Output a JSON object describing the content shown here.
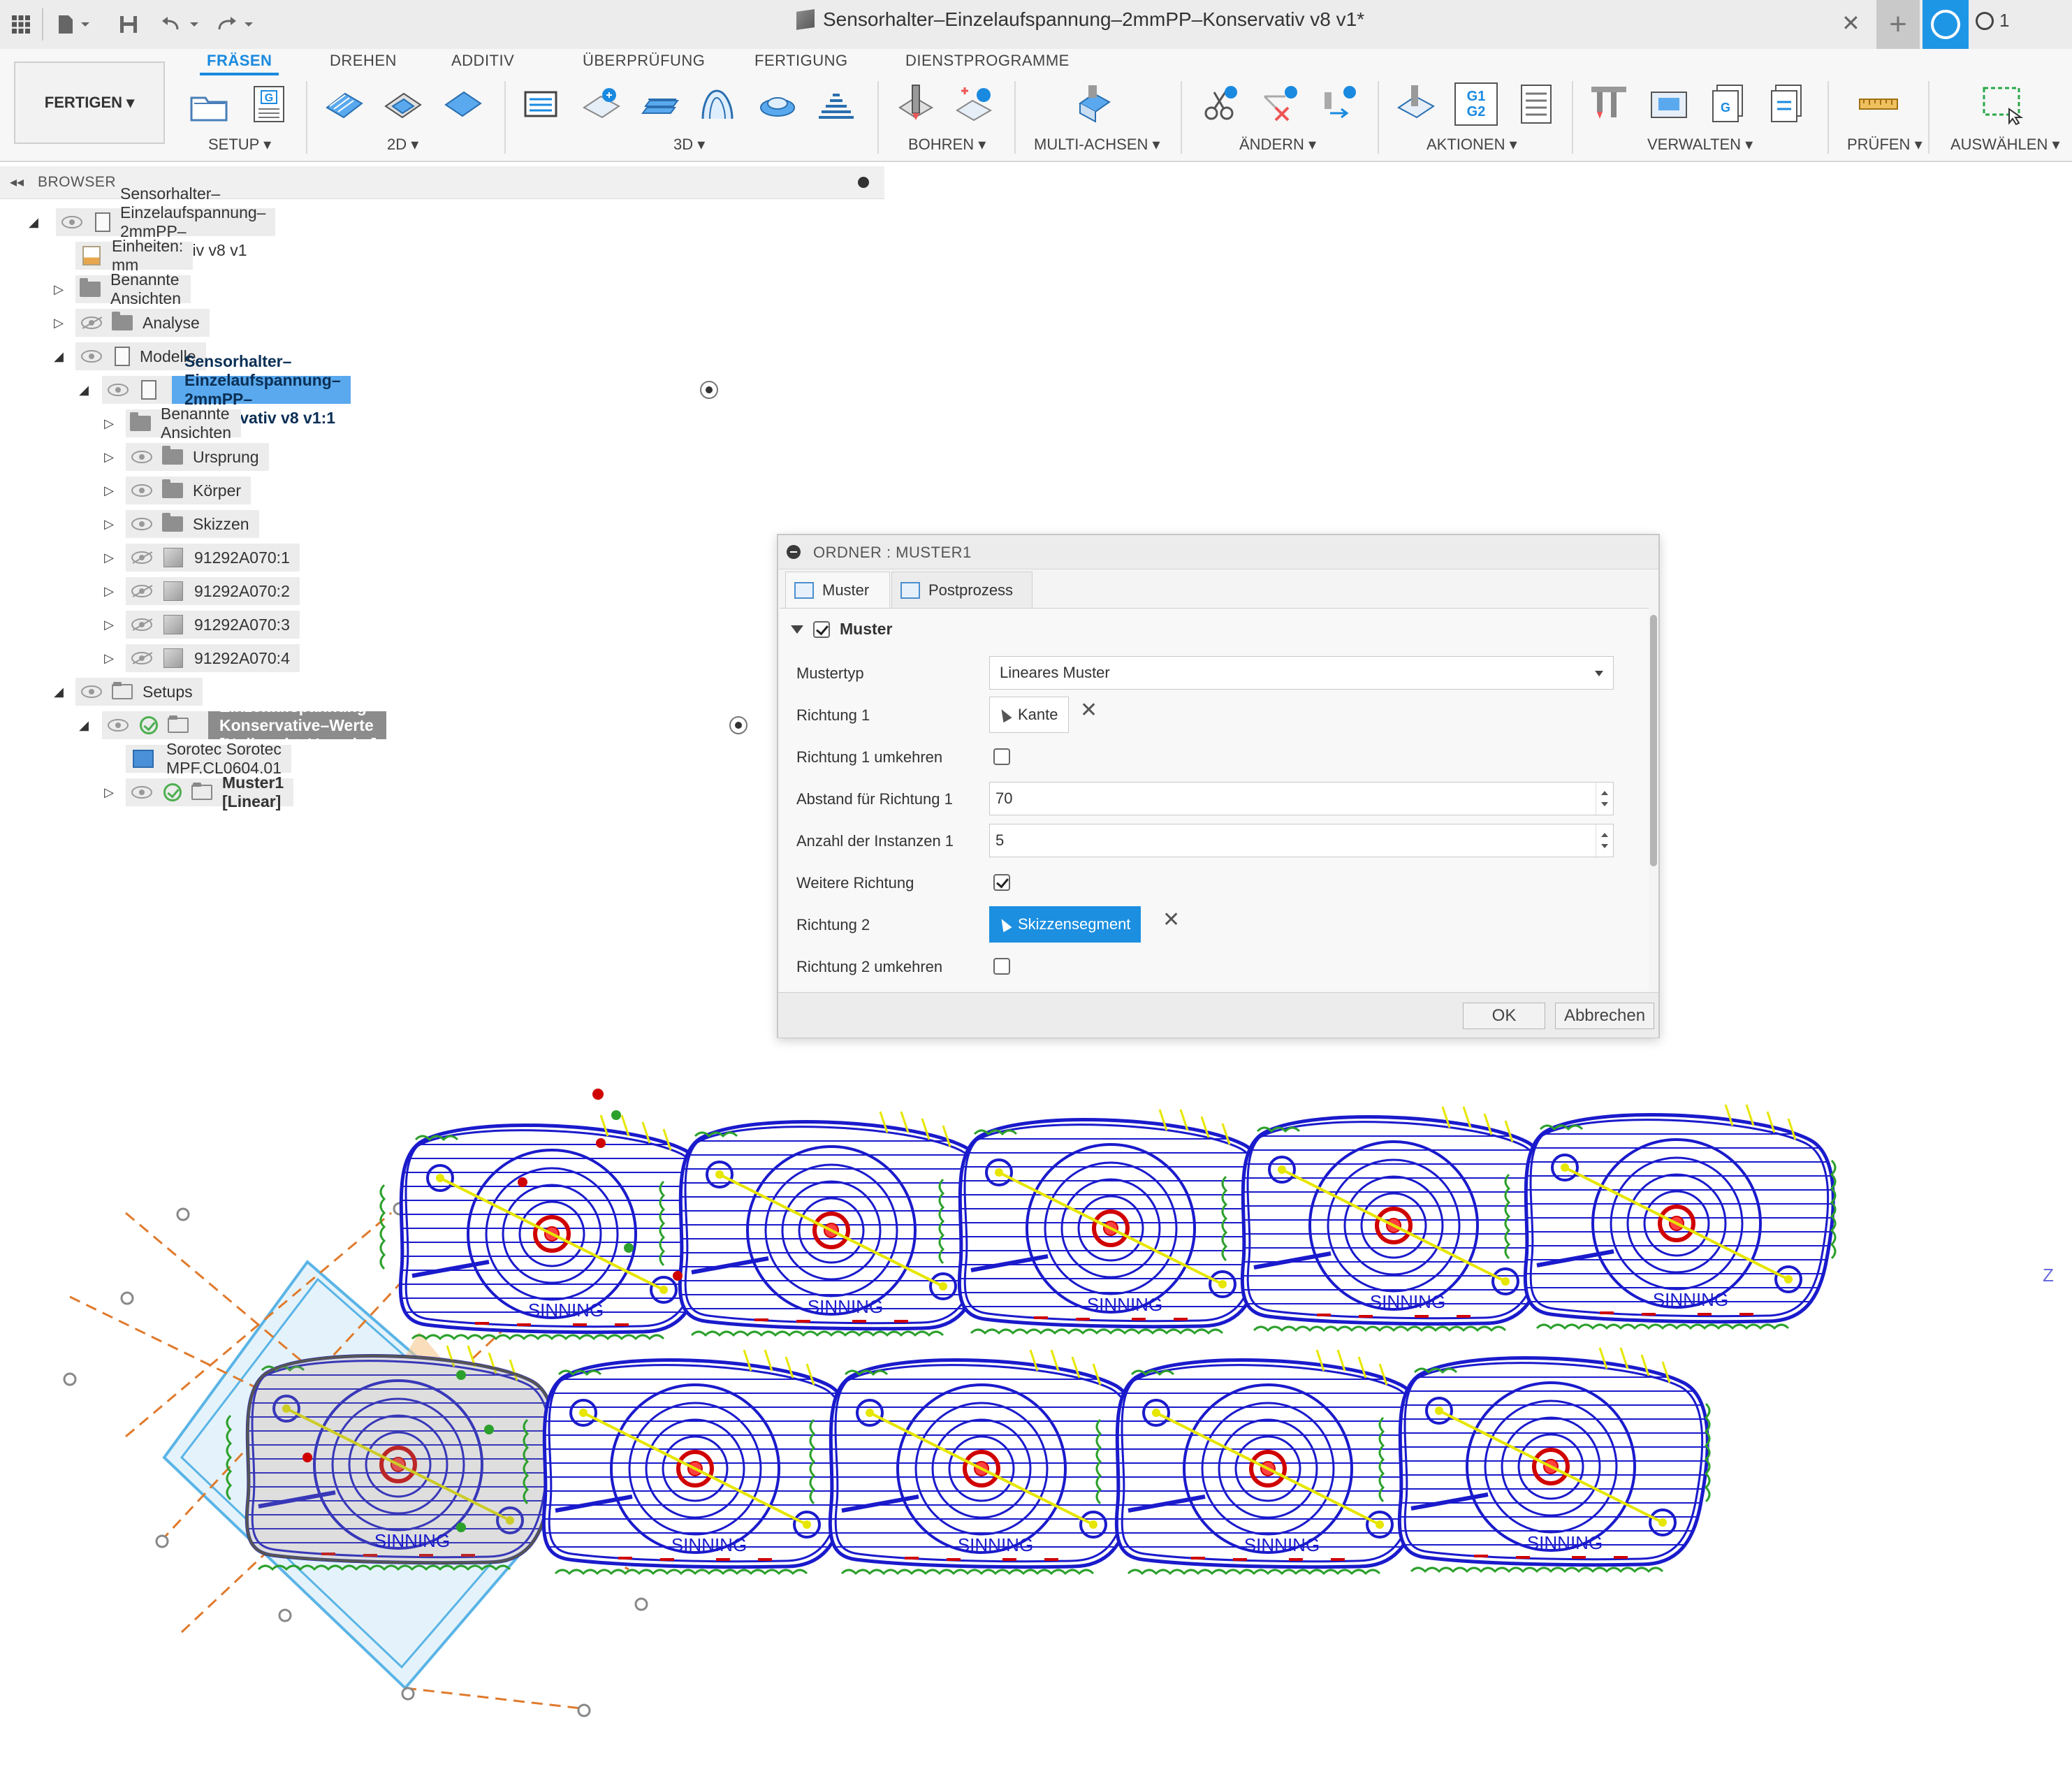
{
  "titlebar": {
    "document_title": "Sensorhalter–Einzelaufspannung–2mmPP–Konservativ v8 v1*",
    "job_count": "1",
    "icons": [
      "grid-icon",
      "file-icon",
      "save-icon",
      "undo-icon",
      "redo-icon",
      "close-icon",
      "plus-icon",
      "sync-icon",
      "clock-icon"
    ]
  },
  "ribbon": {
    "workspace_button": "FERTIGEN",
    "tabs": [
      "FRÄSEN",
      "DREHEN",
      "ADDITIV",
      "ÜBERPRÜFUNG",
      "FERTIGUNG",
      "DIENSTPROGRAMME"
    ],
    "active_tab": "FRÄSEN",
    "groups": [
      "SETUP",
      "2D",
      "3D",
      "BOHREN",
      "MULTI-ACHSEN",
      "ÄNDERN",
      "AKTIONEN",
      "VERWALTEN",
      "PRÜFEN",
      "AUSWÄHLEN"
    ],
    "aktionen_icon_text": [
      "G1",
      "G2"
    ],
    "accent_color": "#1a8ae0"
  },
  "browser": {
    "title": "BROWSER",
    "tree": {
      "root": "Sensorhalter–Einzelaufspannung–2mmPP–Konservativ v8 v1",
      "units": "Einheiten: mm",
      "named_views": "Benannte Ansichten",
      "analysis": "Analyse",
      "models": "Modelle",
      "model_component": "Sensorhalter–Einzelaufspannung–2mmPP–Konservativ v8 v1:1",
      "model_named_views": "Benannte Ansichten",
      "origin": "Ursprung",
      "bodies": "Körper",
      "sketches": "Skizzen",
      "parts": [
        "91292A070:1",
        "91292A070:2",
        "91292A070:3",
        "91292A070:4"
      ],
      "setups": "Setups",
      "setup": "Einzelaufspannung–Konservative–Werte [Nullpunkt=Vorgabe]",
      "machine": "Sorotec Sorotec MPF.CL0604.01",
      "pattern": "Muster1 [Linear]"
    }
  },
  "dialog": {
    "title": "ORDNER : MUSTER1",
    "tabs": [
      "Muster",
      "Postprozess"
    ],
    "section": "Muster",
    "section_checked": true,
    "fields": {
      "pattern_type_label": "Mustertyp",
      "pattern_type_value": "Lineares Muster",
      "dir1_label": "Richtung 1",
      "dir1_value": "Kante",
      "dir1_flip_label": "Richtung 1 umkehren",
      "dir1_flip": false,
      "spacing1_label": "Abstand für Richtung 1",
      "spacing1_value": "70",
      "count1_label": "Anzahl der Instanzen 1",
      "count1_value": "5",
      "more_dir_label": "Weitere Richtung",
      "more_dir": true,
      "dir2_label": "Richtung 2",
      "dir2_value": "Skizzensegment",
      "dir2_flip_label": "Richtung 2 umkehren",
      "dir2_flip": false
    },
    "ok": "OK",
    "cancel": "Abbrechen"
  },
  "viewport": {
    "part_label": "SINNING",
    "axis_label": "Z",
    "toolpath_colors": {
      "path": "#1a1acc",
      "link": "#2ca02c",
      "lead": "#e6e600",
      "plunge": "#d00000"
    }
  }
}
